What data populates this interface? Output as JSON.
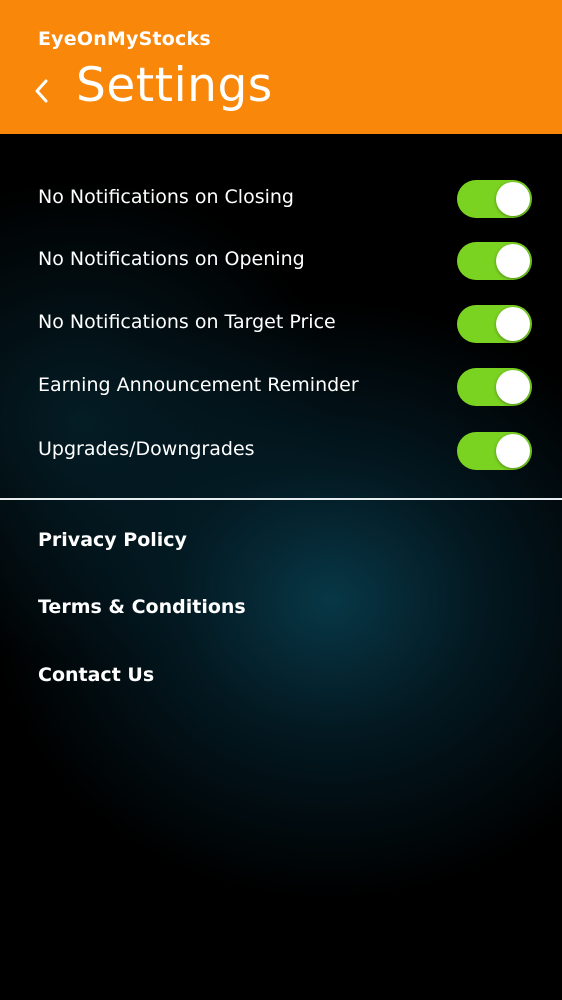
{
  "header": {
    "app_name": "EyeOnMyStocks",
    "title": "Settings",
    "back_icon": "chevron-left-icon",
    "background_color": "#f8870a"
  },
  "toggles": [
    {
      "label": "No Notifications on Closing",
      "on": true
    },
    {
      "label": "No Notifications on Opening",
      "on": true
    },
    {
      "label": "No Notifications on Target Price",
      "on": true
    },
    {
      "label": "Earning Announcement Reminder",
      "on": true
    },
    {
      "label": "Upgrades/Downgrades",
      "on": true
    }
  ],
  "toggle_on_color": "#7ad321",
  "links": [
    {
      "label": "Privacy Policy"
    },
    {
      "label": "Terms & Conditions"
    },
    {
      "label": "Contact Us"
    }
  ]
}
